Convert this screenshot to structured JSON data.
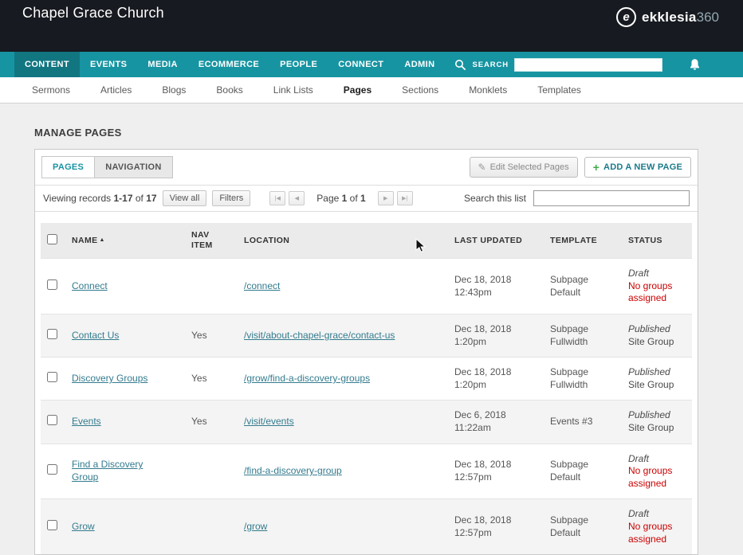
{
  "header": {
    "site_title": "Chapel Grace Church",
    "brand": {
      "icon_letter": "e",
      "name": "ekklesia",
      "suffix": "360"
    }
  },
  "main_nav": {
    "items": [
      {
        "label": "CONTENT"
      },
      {
        "label": "EVENTS"
      },
      {
        "label": "MEDIA"
      },
      {
        "label": "ECOMMERCE"
      },
      {
        "label": "PEOPLE"
      },
      {
        "label": "CONNECT"
      },
      {
        "label": "ADMIN"
      }
    ],
    "search_label": "SEARCH",
    "search_value": ""
  },
  "sub_nav": {
    "items": [
      {
        "label": "Sermons"
      },
      {
        "label": "Articles"
      },
      {
        "label": "Blogs"
      },
      {
        "label": "Books"
      },
      {
        "label": "Link Lists"
      },
      {
        "label": "Pages"
      },
      {
        "label": "Sections"
      },
      {
        "label": "Monklets"
      },
      {
        "label": "Templates"
      }
    ]
  },
  "page": {
    "title": "MANAGE PAGES",
    "tabs": [
      {
        "label": "PAGES"
      },
      {
        "label": "NAVIGATION"
      }
    ],
    "actions": {
      "edit_selected": "Edit Selected Pages",
      "add_new": "ADD A NEW PAGE"
    },
    "toolbar": {
      "viewing_label": "Viewing records",
      "range": "1-17",
      "of_label": "of",
      "total": "17",
      "view_all": "View all",
      "filters": "Filters",
      "page_label": "Page",
      "page_current": "1",
      "page_of": "of",
      "page_total": "1",
      "search_label": "Search this list",
      "search_value": ""
    },
    "table": {
      "headers": {
        "name": "NAME",
        "nav_item": "NAV ITEM",
        "location": "LOCATION",
        "last_updated": "LAST UPDATED",
        "template": "TEMPLATE",
        "status": "STATUS"
      },
      "rows": [
        {
          "name": "Connect",
          "nav_item": "",
          "location": "/connect",
          "updated_date": "Dec 18, 2018",
          "updated_time": "12:43pm",
          "template_1": "Subpage",
          "template_2": "Default",
          "status": "Draft",
          "status_detail": "No groups assigned"
        },
        {
          "name": "Contact Us",
          "nav_item": "Yes",
          "location": "/visit/about-chapel-grace/contact-us",
          "updated_date": "Dec 18, 2018",
          "updated_time": "1:20pm",
          "template_1": "Subpage",
          "template_2": "Fullwidth",
          "status": "Published",
          "status_detail": "Site Group"
        },
        {
          "name": "Discovery Groups",
          "nav_item": "Yes",
          "location": "/grow/find-a-discovery-groups",
          "updated_date": "Dec 18, 2018",
          "updated_time": "1:20pm",
          "template_1": "Subpage",
          "template_2": "Fullwidth",
          "status": "Published",
          "status_detail": "Site Group"
        },
        {
          "name": "Events",
          "nav_item": "Yes",
          "location": "/visit/events",
          "updated_date": "Dec 6, 2018",
          "updated_time": "11:22am",
          "template_1": "Events #3",
          "template_2": "",
          "status": "Published",
          "status_detail": "Site Group"
        },
        {
          "name": "Find a Discovery Group",
          "nav_item": "",
          "location": "/find-a-discovery-group",
          "updated_date": "Dec 18, 2018",
          "updated_time": "12:57pm",
          "template_1": "Subpage",
          "template_2": "Default",
          "status": "Draft",
          "status_detail": "No groups assigned"
        },
        {
          "name": "Grow",
          "nav_item": "",
          "location": "/grow",
          "updated_date": "Dec 18, 2018",
          "updated_time": "12:57pm",
          "template_1": "Subpage",
          "template_2": "Default",
          "status": "Draft",
          "status_detail": "No groups assigned"
        }
      ]
    }
  },
  "icons": {
    "sort_asc": "▲",
    "plus": "+",
    "edit": "✎",
    "pag_first": "|◀",
    "pag_prev": "◀",
    "pag_next": "▶",
    "pag_last": "▶|"
  },
  "colors": {
    "teal": "#1794a2",
    "link": "#337b8e",
    "status_red": "#cc0000"
  }
}
